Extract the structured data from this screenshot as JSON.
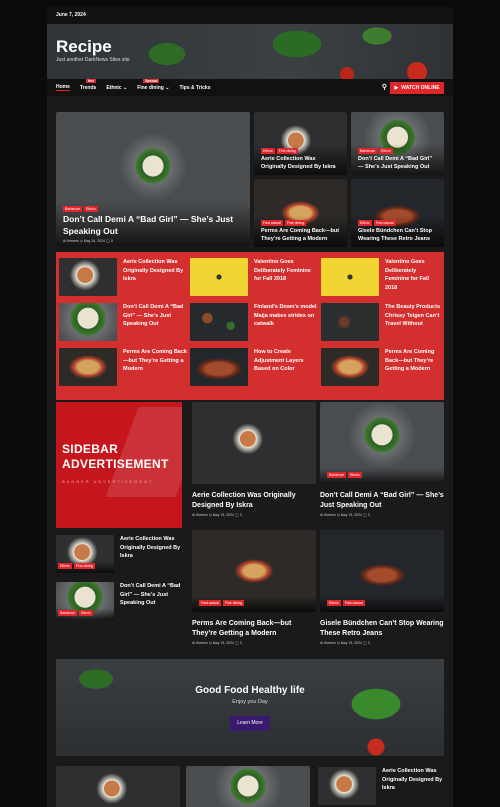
{
  "topbar": {
    "date": "June 7, 2024"
  },
  "site": {
    "title": "Recipe",
    "tagline": "Just another DarkNews Sites site"
  },
  "nav": {
    "items": [
      {
        "label": "Home"
      },
      {
        "label": "Trends",
        "badge": "Hot"
      },
      {
        "label": "Ethnic"
      },
      {
        "label": "Fine dining",
        "badge": "Special"
      },
      {
        "label": "Tips & Tricks"
      }
    ],
    "watch_label": "WATCH ONLINE",
    "icons": {
      "search": "search-icon",
      "play": "play-icon",
      "chevron": "chevron-down-icon"
    }
  },
  "main_feature": {
    "cats": [
      "Barbecue",
      "Ethnic"
    ],
    "title": "Don’t Call Demi A “Bad Girl” — She’s Just Speaking Out",
    "meta": "AI themes  ◷ May 19, 2024  ◯ 0"
  },
  "side_features": [
    {
      "cats": [
        "Ethnic",
        "Fine dining"
      ],
      "title": "Aerie Collection Was Originally Designed By Iskra"
    },
    {
      "cats": [
        "Barbecue",
        "Ethnic"
      ],
      "title": "Don’t Call Demi A “Bad Girl” — She’s Just Speaking Out"
    },
    {
      "cats": [
        "Fast casual",
        "Fine dining"
      ],
      "title": "Perms Are Coming Back—but They’re Getting a Modern"
    },
    {
      "cats": [
        "Ethnic",
        "Fast casual"
      ],
      "title": "Gisele Bündchen Can’t Stop Wearing These Retro Jeans"
    }
  ],
  "red_grid": [
    "Aerie Collection Was Originally Designed By Iskra",
    "Valentino Goes Deliberately Feminine for Fall 2018",
    "Valentino Goes Deliberately Feminine for Fall 2018",
    "Don’t Call Demi A “Bad Girl” — She’s Just Speaking Out",
    "Finland’s Down’s model Maija makes strides on catwalk",
    "The Beauty Products Chrissy Teigen Can’t Travel Without",
    "Perms Are Coming Back—but They’re Getting a Modern",
    "How to Create Adjustment Layers Based on Color",
    "Perms Are Coming Back—but They’re Getting a Modern"
  ],
  "ad": {
    "line1": "SIDEBAR",
    "line2": "ADVERTISEMENT",
    "line3": "BANNER ADVERTISEMENT"
  },
  "cards": [
    {
      "cats": [],
      "title": "Aerie Collection Was Originally Designed By Iskra",
      "meta": "AI themes  ◷ May 19, 2024  ◯ 0"
    },
    {
      "cats": [
        "Barbecue",
        "Ethnic"
      ],
      "title": "Don’t Call Demi A “Bad Girl” — She’s Just Speaking Out",
      "meta": "AI themes  ◷ May 19, 2024  ◯ 0"
    },
    {
      "cats": [
        "Fast casual",
        "Fine dining"
      ],
      "title": "Perms Are Coming Back—but They’re Getting a Modern",
      "meta": "AI themes  ◷ May 19, 2024  ◯ 0"
    },
    {
      "cats": [
        "Ethnic",
        "Fast casual"
      ],
      "title": "Gisele Bündchen Can’t Stop Wearing These Retro Jeans",
      "meta": "AI themes  ◷ May 19, 2024  ◯ 0"
    }
  ],
  "small_list": [
    {
      "cats": [
        "Ethnic",
        "Fine dining"
      ],
      "title": "Aerie Collection Was Originally Designed By Iskra"
    },
    {
      "cats": [
        "Barbecue",
        "Ethnic"
      ],
      "title": "Don’t Call Demi A “Bad Girl” — She’s Just Speaking Out"
    }
  ],
  "promo": {
    "heading": "Good Food Healthy life",
    "sub": "Enjoy you Day",
    "button": "Learn More"
  },
  "bottom": {
    "title": "Aerie Collection Was Originally Designed By Iskra"
  }
}
